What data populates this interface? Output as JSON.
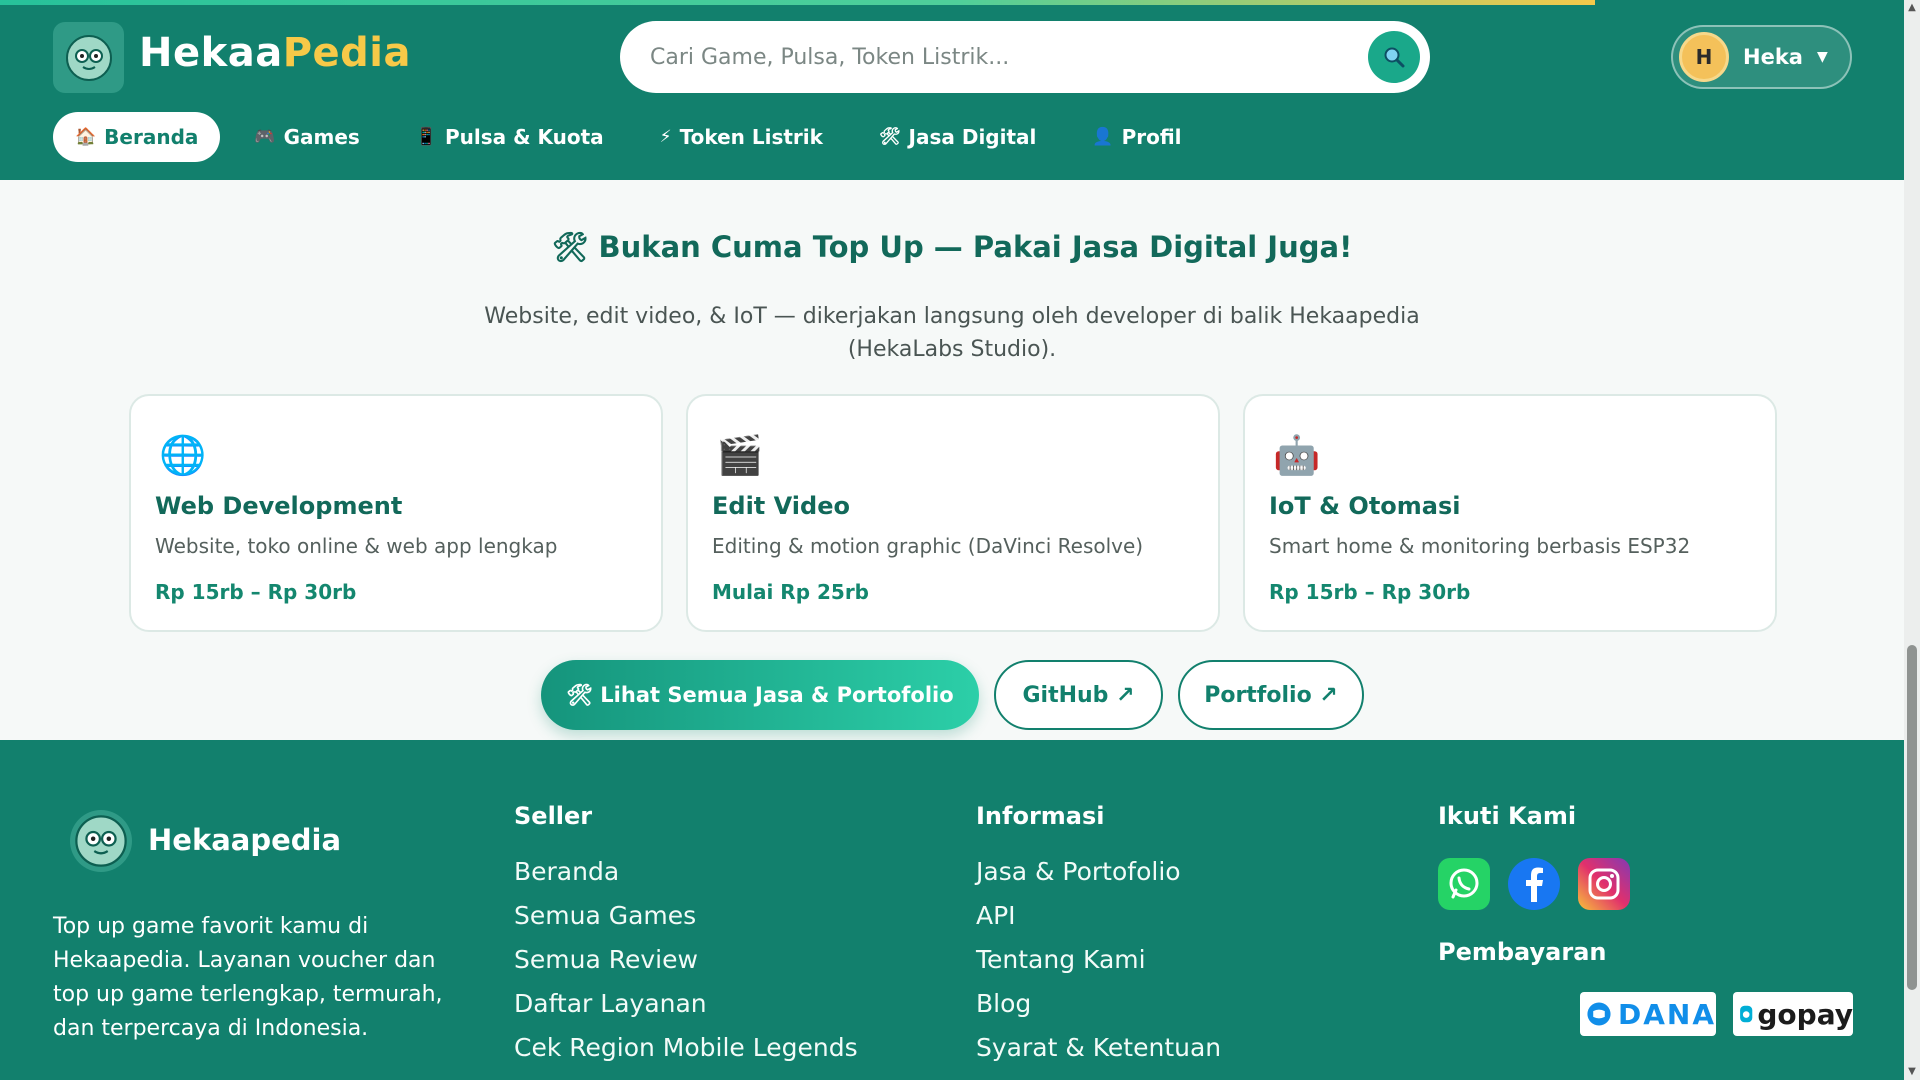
{
  "colors": {
    "primary": "#12806d",
    "accent": "#f7c948",
    "background": "#f6f9f8"
  },
  "header": {
    "brand_main": "Hekaa",
    "brand_accent": "Pedia",
    "search_placeholder": "Cari Game, Pulsa, Token Listrik...",
    "user": {
      "initial": "H",
      "name": "Heka",
      "caret": "▼"
    }
  },
  "nav": [
    {
      "icon": "🏠",
      "label": "Beranda"
    },
    {
      "icon": "🎮",
      "label": "Games"
    },
    {
      "icon": "📱",
      "label": "Pulsa & Kuota"
    },
    {
      "icon": "⚡",
      "label": "Token Listrik"
    },
    {
      "icon": "🛠",
      "label": "Jasa Digital"
    },
    {
      "icon": "👤",
      "label": "Profil"
    }
  ],
  "main": {
    "title_icon": "🛠",
    "title": "Bukan Cuma Top Up — Pakai Jasa Digital Juga!",
    "subtitle": "Website, edit video, & IoT — dikerjakan langsung oleh developer di balik Hekaapedia (HekaLabs Studio).",
    "cards": [
      {
        "icon": "🌐",
        "title": "Web Development",
        "desc": "Website, toko online & web app lengkap",
        "price": "Rp 15rb – Rp 30rb"
      },
      {
        "icon": "🎬",
        "title": "Edit Video",
        "desc": "Editing & motion graphic (DaVinci Resolve)",
        "price": "Mulai Rp 25rb"
      },
      {
        "icon": "🤖",
        "title": "IoT & Otomasi",
        "desc": "Smart home & monitoring berbasis ESP32",
        "price": "Rp 15rb – Rp 30rb"
      }
    ],
    "btn_primary": "🛠 Lihat Semua Jasa & Portofolio",
    "btn_github": "GitHub ↗",
    "btn_portfolio": "Portfolio ↗"
  },
  "footer": {
    "brand": "Hekaapedia",
    "about": "Top up game favorit kamu di Hekaapedia. Layanan voucher dan top up game terlengkap, termurah, dan terpercaya di Indonesia.",
    "seller": {
      "heading": "Seller",
      "links": [
        "Beranda",
        "Semua Games",
        "Semua Review",
        "Daftar Layanan",
        "Cek Region Mobile Legends"
      ]
    },
    "info": {
      "heading": "Informasi",
      "links": [
        "Jasa & Portofolio",
        "API",
        "Tentang Kami",
        "Blog",
        "Syarat & Ketentuan"
      ]
    },
    "follow_heading": "Ikuti Kami",
    "social": [
      "whatsapp-icon",
      "facebook-icon",
      "instagram-icon"
    ],
    "payment_heading": "Pembayaran",
    "payments": [
      "DANA",
      "gopay"
    ]
  }
}
